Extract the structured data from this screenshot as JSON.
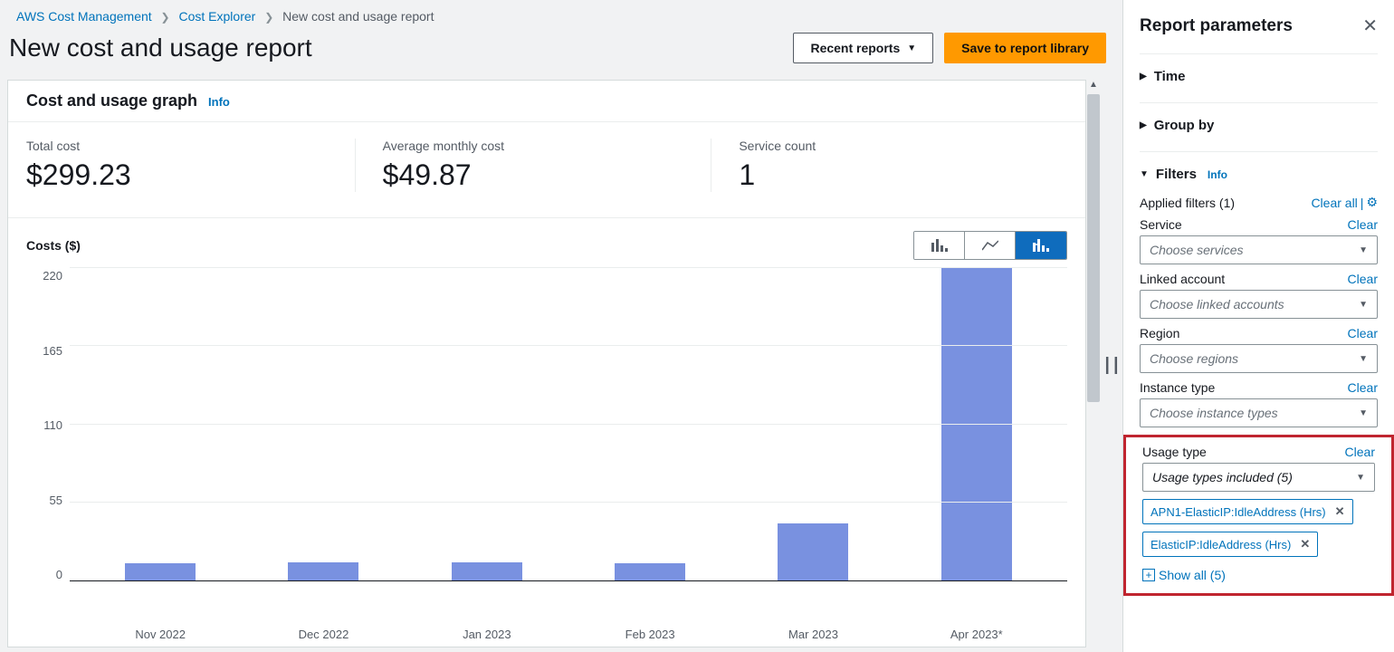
{
  "breadcrumb": {
    "l1": "AWS Cost Management",
    "l2": "Cost Explorer",
    "l3": "New cost and usage report"
  },
  "header": {
    "title": "New cost and usage report",
    "recent_reports_btn": "Recent reports",
    "save_btn": "Save to report library"
  },
  "card": {
    "title": "Cost and usage graph",
    "info": "Info"
  },
  "metrics": {
    "total_cost": {
      "label": "Total cost",
      "value": "$299.23"
    },
    "avg_monthly": {
      "label": "Average monthly cost",
      "value": "$49.87"
    },
    "service_count": {
      "label": "Service count",
      "value": "1"
    }
  },
  "chart_data": {
    "type": "bar",
    "ylabel": "Costs ($)",
    "categories": [
      "Nov 2022",
      "Dec 2022",
      "Jan 2023",
      "Feb 2023",
      "Mar 2023",
      "Apr 2023*"
    ],
    "values": [
      12,
      13,
      13,
      12,
      40,
      220
    ],
    "yticks": [
      0,
      55,
      110,
      165,
      220
    ],
    "ylim": [
      0,
      220
    ]
  },
  "sidebar": {
    "title": "Report parameters",
    "sections": {
      "time": "Time",
      "group_by": "Group by",
      "filters": "Filters",
      "filters_info": "Info"
    },
    "applied_filters_label": "Applied filters (1)",
    "clear_all_label": "Clear all",
    "filters": {
      "service": {
        "label": "Service",
        "clear": "Clear",
        "placeholder": "Choose services"
      },
      "linked_account": {
        "label": "Linked account",
        "clear": "Clear",
        "placeholder": "Choose linked accounts"
      },
      "region": {
        "label": "Region",
        "clear": "Clear",
        "placeholder": "Choose regions"
      },
      "instance_type": {
        "label": "Instance type",
        "clear": "Clear",
        "placeholder": "Choose instance types"
      },
      "usage_type": {
        "label": "Usage type",
        "clear": "Clear",
        "placeholder": "Usage types included (5)",
        "tags": [
          "APN1-ElasticIP:IdleAddress (Hrs)",
          "ElasticIP:IdleAddress (Hrs)"
        ],
        "show_all": "Show all (5)"
      }
    }
  }
}
